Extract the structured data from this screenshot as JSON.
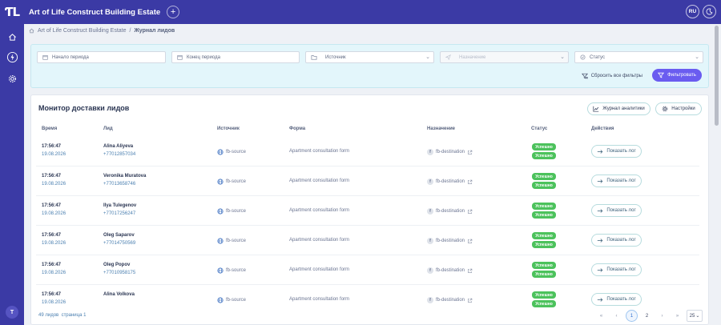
{
  "header": {
    "logo": "ƬL",
    "app_title": "Art of Life Construct Building Estate",
    "add_icon": "plus-icon",
    "lang": "RU",
    "theme_icon": "moon-icon"
  },
  "sidebar": {
    "items": [
      {
        "icon": "home-icon"
      },
      {
        "icon": "lightning-icon"
      },
      {
        "icon": "gear-icon"
      }
    ],
    "avatar": "T"
  },
  "breadcrumb": {
    "root": "Art of Life Construct Building Estate",
    "separator": "/",
    "current": "Журнал лидов"
  },
  "filters": {
    "period_start_placeholder": "Начало периода",
    "period_end_placeholder": "Конец периода",
    "source_placeholder": "Источник",
    "destination_placeholder": "Назначение",
    "status_placeholder": "Статус",
    "reset_label": "Сбросить все фильтры",
    "apply_label": "Фильтровать"
  },
  "monitor": {
    "title": "Монитор доставки лидов",
    "analytics_button": "Журнал аналитики",
    "settings_button": "Настройки",
    "columns": [
      "Время",
      "Лид",
      "Источник",
      "Форма",
      "Назначение",
      "Статус",
      "Действия"
    ],
    "rows": [
      {
        "time": "17:56:47",
        "date": "19.08.2026",
        "name": "Alina Aliyeva",
        "phone": "+77012857034",
        "source": "fb-source",
        "form": "Apartment consultation form",
        "destination": "fb-destination",
        "statuses": [
          "Успешно",
          "Успешно"
        ],
        "action": "Показать лог"
      },
      {
        "time": "17:56:47",
        "date": "19.08.2026",
        "name": "Veronika Muratova",
        "phone": "+77013658746",
        "source": "fb-source",
        "form": "Apartment consultation form",
        "destination": "fb-destination",
        "statuses": [
          "Успешно",
          "Успешно"
        ],
        "action": "Показать лог"
      },
      {
        "time": "17:56:47",
        "date": "19.08.2026",
        "name": "Ilya Tulegenov",
        "phone": "+77017256247",
        "source": "fb-source",
        "form": "Apartment consultation form",
        "destination": "fb-destination",
        "statuses": [
          "Успешно",
          "Успешно"
        ],
        "action": "Показать лог"
      },
      {
        "time": "17:56:47",
        "date": "19.08.2026",
        "name": "Oleg Saparov",
        "phone": "+77014750569",
        "source": "fb-source",
        "form": "Apartment consultation form",
        "destination": "fb-destination",
        "statuses": [
          "Успешно",
          "Успешно"
        ],
        "action": "Показать лог"
      },
      {
        "time": "17:56:47",
        "date": "19.08.2026",
        "name": "Oleg Popov",
        "phone": "+77010958175",
        "source": "fb-source",
        "form": "Apartment consultation form",
        "destination": "fb-destination",
        "statuses": [
          "Успешно",
          "Успешно"
        ],
        "action": "Показать лог"
      },
      {
        "time": "17:56:47",
        "date": "19.08.2026",
        "name": "Alina Volkova",
        "phone": "",
        "source": "fb-source",
        "form": "Apartment consultation form",
        "destination": "fb-destination",
        "statuses": [
          "Успешно",
          "Успешно"
        ],
        "action": "Показать лог"
      }
    ]
  },
  "pagination": {
    "summary_count": "49 лидов",
    "summary_page": "страница 1",
    "first": "«",
    "prev": "‹",
    "pages": [
      "1",
      "2"
    ],
    "active_page": "1",
    "next": "›",
    "last": "»",
    "page_size": "25"
  },
  "colors": {
    "brand": "#3b3aa5",
    "accent": "#6a5cf0",
    "success": "#4cc25c",
    "filter_bg": "#e3f6fb"
  }
}
